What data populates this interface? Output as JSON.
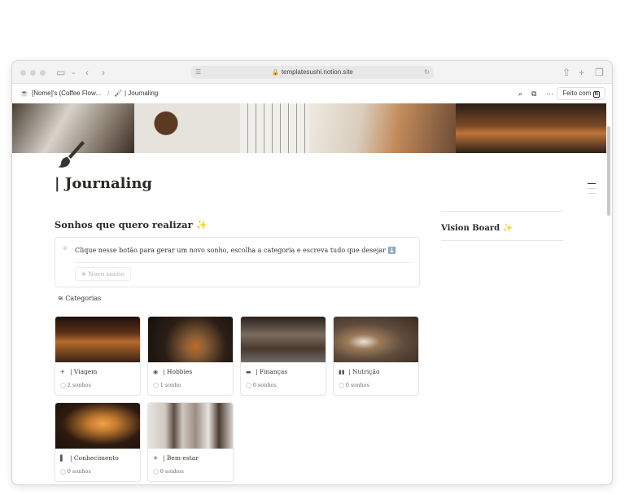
{
  "browser": {
    "url": "templatesushi.notion.site"
  },
  "breadcrumb": {
    "parent": "[Nome]'s (Coffee Flow...",
    "separator": "/",
    "current": "| Journaling"
  },
  "nav": {
    "done_button": "Feito com"
  },
  "page": {
    "title": "| Journaling"
  },
  "dreams": {
    "heading": "Sonhos que quero realizar",
    "sparkle": "✨",
    "callout_text": "Clique nesse botão para gerar um novo sonho, escolha a categoria e escreva tudo que desejar",
    "callout_emoji": "⬇️",
    "new_button": "Novo sonho"
  },
  "categories_label": "Categorias",
  "cards": [
    {
      "title": "| Viagem",
      "count": "2 sonhos",
      "icon": "airplane-icon",
      "image_colors": [
        "#3a2214",
        "#b56a2c",
        "#1d120a"
      ]
    },
    {
      "title": "| Hobbies",
      "count": "1 sonho",
      "icon": "palette-icon",
      "image_colors": [
        "#2a1f17",
        "#8a5e36",
        "#15100c"
      ]
    },
    {
      "title": "| Finanças",
      "count": "0 sonhos",
      "icon": "wallet-icon",
      "image_colors": [
        "#4a3a2e",
        "#7a6b5f",
        "#2b221c"
      ]
    },
    {
      "title": "| Nutrição",
      "count": "0 sonhos",
      "icon": "bottles-icon",
      "image_colors": [
        "#3b2a1e",
        "#9d7a58",
        "#5e4c3e"
      ]
    },
    {
      "title": "| Conhecimento",
      "count": "0 sonhos",
      "icon": "book-icon",
      "image_colors": [
        "#2e1b10",
        "#c07a30",
        "#1a0f08"
      ]
    },
    {
      "title": "| Bem-estar",
      "count": "0 sonhos",
      "icon": "sun-icon",
      "image_colors": [
        "#cfc8c0",
        "#9b8e84",
        "#e7e3df"
      ]
    }
  ],
  "vision_board": {
    "heading": "Vision Board",
    "sparkle": "✨"
  }
}
